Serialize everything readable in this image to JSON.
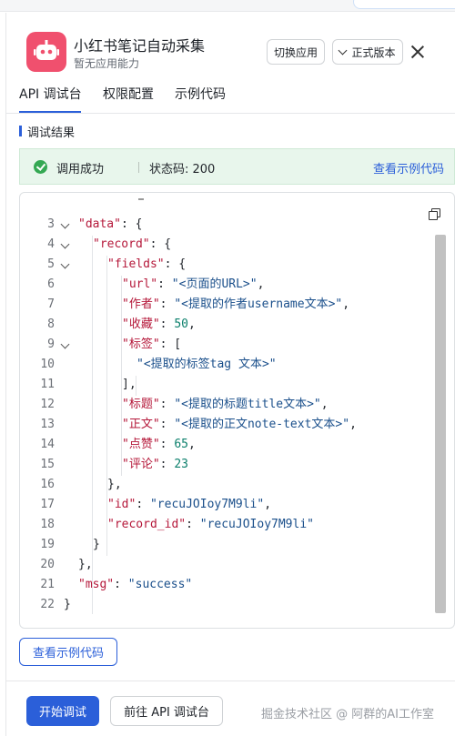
{
  "app": {
    "title": "小红书笔记自动采集",
    "subtitle": "暂无应用能力",
    "icon": "robot-icon",
    "icon_color": "#f0506e"
  },
  "header": {
    "switch_label": "切换应用",
    "version_label": "正式版本"
  },
  "tabs": [
    {
      "label": "API 调试台"
    },
    {
      "label": "权限配置"
    },
    {
      "label": "示例代码"
    }
  ],
  "section": {
    "title": "调试结果"
  },
  "status": {
    "result": "调用成功",
    "code_text": "状态码: 200",
    "link": "查看示例代码",
    "color": "#34a853"
  },
  "code": {
    "lines": [
      {
        "num": "3",
        "segs": [
          {
            "t": "\"data\"",
            "c": "k"
          },
          {
            "t": ": {",
            "c": "p"
          }
        ]
      },
      {
        "num": "4",
        "segs": [
          {
            "t": "\"record\"",
            "c": "k"
          },
          {
            "t": ": {",
            "c": "p"
          }
        ]
      },
      {
        "num": "5",
        "segs": [
          {
            "t": "\"fields\"",
            "c": "k"
          },
          {
            "t": ": {",
            "c": "p"
          }
        ]
      },
      {
        "num": "6",
        "segs": [
          {
            "t": "\"url\"",
            "c": "k"
          },
          {
            "t": ": ",
            "c": "p"
          },
          {
            "t": "\"<页面的URL>\"",
            "c": "s"
          },
          {
            "t": ",",
            "c": "p"
          }
        ]
      },
      {
        "num": "7",
        "segs": [
          {
            "t": "\"作者\"",
            "c": "k"
          },
          {
            "t": ": ",
            "c": "p"
          },
          {
            "t": "\"<提取的作者username文本>\"",
            "c": "s"
          },
          {
            "t": ",",
            "c": "p"
          }
        ]
      },
      {
        "num": "8",
        "segs": [
          {
            "t": "\"收藏\"",
            "c": "k"
          },
          {
            "t": ": ",
            "c": "p"
          },
          {
            "t": "50",
            "c": "n"
          },
          {
            "t": ",",
            "c": "p"
          }
        ]
      },
      {
        "num": "9",
        "segs": [
          {
            "t": "\"标签\"",
            "c": "k"
          },
          {
            "t": ": [",
            "c": "p"
          }
        ]
      },
      {
        "num": "10",
        "segs": [
          {
            "t": "\"<提取的标签tag 文本>\"",
            "c": "s"
          }
        ]
      },
      {
        "num": "11",
        "segs": [
          {
            "t": "],",
            "c": "p"
          }
        ]
      },
      {
        "num": "12",
        "segs": [
          {
            "t": "\"标题\"",
            "c": "k"
          },
          {
            "t": ": ",
            "c": "p"
          },
          {
            "t": "\"<提取的标题title文本>\"",
            "c": "s"
          },
          {
            "t": ",",
            "c": "p"
          }
        ]
      },
      {
        "num": "13",
        "segs": [
          {
            "t": "\"正文\"",
            "c": "k"
          },
          {
            "t": ": ",
            "c": "p"
          },
          {
            "t": "\"<提取的正文note-text文本>\"",
            "c": "s"
          },
          {
            "t": ",",
            "c": "p"
          }
        ]
      },
      {
        "num": "14",
        "segs": [
          {
            "t": "\"点赞\"",
            "c": "k"
          },
          {
            "t": ": ",
            "c": "p"
          },
          {
            "t": "65",
            "c": "n"
          },
          {
            "t": ",",
            "c": "p"
          }
        ]
      },
      {
        "num": "15",
        "segs": [
          {
            "t": "\"评论\"",
            "c": "k"
          },
          {
            "t": ": ",
            "c": "p"
          },
          {
            "t": "23",
            "c": "n"
          }
        ]
      },
      {
        "num": "16",
        "segs": [
          {
            "t": "},",
            "c": "p"
          }
        ]
      },
      {
        "num": "17",
        "segs": [
          {
            "t": "\"id\"",
            "c": "k"
          },
          {
            "t": ": ",
            "c": "p"
          },
          {
            "t": "\"recuJOIoy7M9li\"",
            "c": "s"
          },
          {
            "t": ",",
            "c": "p"
          }
        ]
      },
      {
        "num": "18",
        "segs": [
          {
            "t": "\"record_id\"",
            "c": "k"
          },
          {
            "t": ": ",
            "c": "p"
          },
          {
            "t": "\"recuJOIoy7M9li\"",
            "c": "s"
          }
        ]
      },
      {
        "num": "19",
        "segs": [
          {
            "t": "}",
            "c": "p"
          }
        ]
      },
      {
        "num": "20",
        "segs": [
          {
            "t": "},",
            "c": "p"
          }
        ]
      },
      {
        "num": "21",
        "segs": [
          {
            "t": "\"msg\"",
            "c": "k"
          },
          {
            "t": ": ",
            "c": "p"
          },
          {
            "t": "\"success\"",
            "c": "s"
          }
        ]
      },
      {
        "num": "22",
        "segs": [
          {
            "t": "}",
            "c": "p"
          }
        ]
      }
    ]
  },
  "actions": {
    "view_code": "查看示例代码",
    "start": "开始调试",
    "goto": "前往 API 调试台"
  },
  "watermark": "掘金技术社区 @ 阿群的AI工作室",
  "colors": {
    "accent": "#2b5fd9",
    "key": "#b5183a",
    "string": "#1a4f8b",
    "number": "#0b7f6b"
  }
}
